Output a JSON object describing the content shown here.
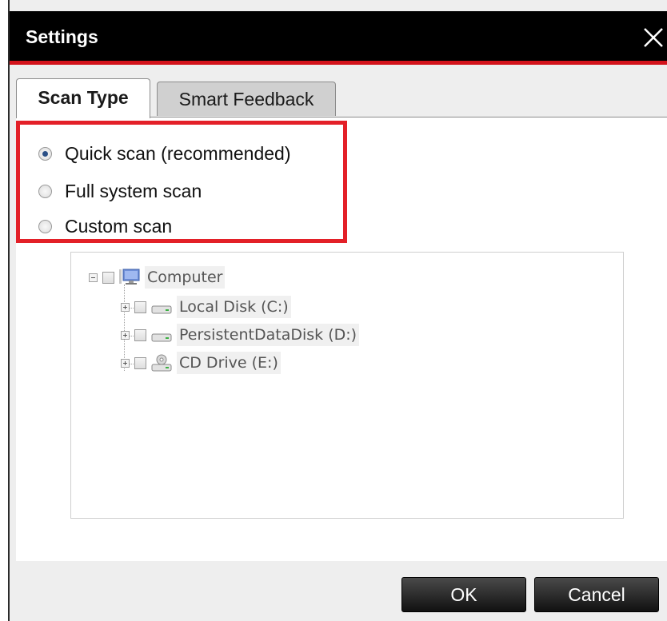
{
  "window": {
    "title": "Settings",
    "close_icon": "close-icon",
    "accent_color": "#d3131b"
  },
  "tabs": [
    {
      "label": "Scan Type",
      "active": true
    },
    {
      "label": "Smart Feedback",
      "active": false
    }
  ],
  "scan_options": [
    {
      "label": "Quick scan (recommended)",
      "checked": true
    },
    {
      "label": "Full system scan",
      "checked": false
    },
    {
      "label": "Custom scan",
      "checked": false
    }
  ],
  "tree": {
    "root": {
      "label": "Computer",
      "icon": "computer-icon",
      "expanded": true
    },
    "children": [
      {
        "label": "Local Disk (C:)",
        "icon": "hard-drive-icon",
        "expanded": false
      },
      {
        "label": "PersistentDataDisk (D:)",
        "icon": "hard-drive-icon",
        "expanded": false
      },
      {
        "label": "CD Drive (E:)",
        "icon": "cd-drive-icon",
        "expanded": false
      }
    ]
  },
  "buttons": {
    "ok_label": "OK",
    "cancel_label": "Cancel"
  }
}
